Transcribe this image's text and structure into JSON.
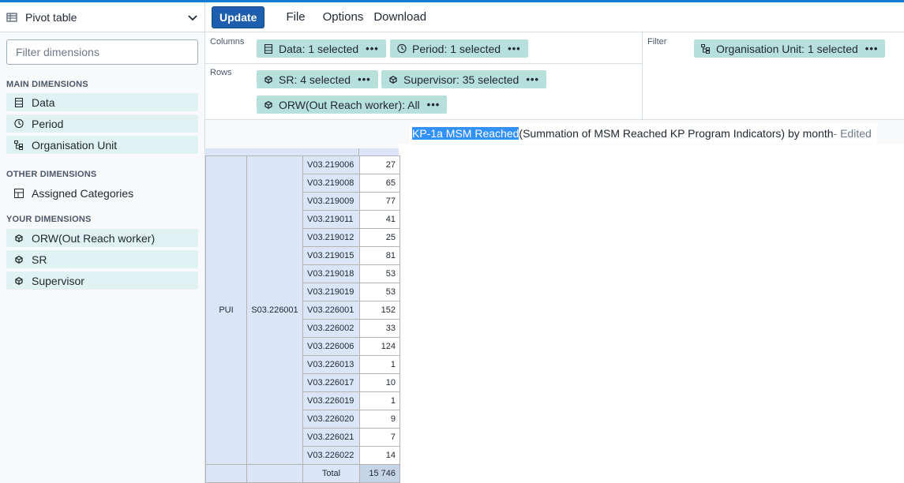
{
  "sidebar": {
    "vis_type": "Pivot table",
    "filter_placeholder": "Filter dimensions",
    "main_header": "MAIN DIMENSIONS",
    "main_items": [
      {
        "label": "Data",
        "icon": "data-icon"
      },
      {
        "label": "Period",
        "icon": "clock-icon"
      },
      {
        "label": "Organisation Unit",
        "icon": "org-tree-icon"
      }
    ],
    "other_header": "OTHER DIMENSIONS",
    "other_items": [
      {
        "label": "Assigned Categories",
        "icon": "grid-icon"
      }
    ],
    "your_header": "YOUR DIMENSIONS",
    "your_items": [
      {
        "label": "ORW(Out Reach worker)",
        "icon": "cube-icon"
      },
      {
        "label": "SR",
        "icon": "cube-icon"
      },
      {
        "label": "Supervisor",
        "icon": "cube-icon"
      }
    ]
  },
  "menubar": {
    "update": "Update",
    "file": "File",
    "options": "Options",
    "download": "Download"
  },
  "layout": {
    "columns_label": "Columns",
    "rows_label": "Rows",
    "filter_label": "Filter",
    "columns": [
      {
        "label": "Data: 1 selected",
        "icon": "data-icon"
      },
      {
        "label": "Period: 1 selected",
        "icon": "clock-icon"
      }
    ],
    "rows": [
      {
        "label": "SR: 4 selected",
        "icon": "cube-icon"
      },
      {
        "label": "Supervisor: 35 selected",
        "icon": "cube-icon"
      },
      {
        "label": "ORW(Out Reach worker): All",
        "icon": "cube-icon"
      }
    ],
    "filter": [
      {
        "label": "Organisation Unit: 1 selected",
        "icon": "org-tree-icon"
      }
    ],
    "dots": "•••"
  },
  "title": {
    "highlighted": "KP-1a MSM Reached",
    "rest": " (Summation of MSM Reached KP Program Indicators) by month",
    "edited": " - Edited"
  },
  "pivot": {
    "sr": "PUI",
    "supervisor": "S03.226001",
    "rows": [
      {
        "orw": "V03.219006",
        "value": "27"
      },
      {
        "orw": "V03.219008",
        "value": "65"
      },
      {
        "orw": "V03.219009",
        "value": "77"
      },
      {
        "orw": "V03.219011",
        "value": "41"
      },
      {
        "orw": "V03.219012",
        "value": "25"
      },
      {
        "orw": "V03.219015",
        "value": "81"
      },
      {
        "orw": "V03.219018",
        "value": "53"
      },
      {
        "orw": "V03.219019",
        "value": "53"
      },
      {
        "orw": "V03.226001",
        "value": "152"
      },
      {
        "orw": "V03.226002",
        "value": "33"
      },
      {
        "orw": "V03.226006",
        "value": "124"
      },
      {
        "orw": "V03.226013",
        "value": "1"
      },
      {
        "orw": "V03.226017",
        "value": "10"
      },
      {
        "orw": "V03.226019",
        "value": "1"
      },
      {
        "orw": "V03.226020",
        "value": "9"
      },
      {
        "orw": "V03.226021",
        "value": "7"
      },
      {
        "orw": "V03.226022",
        "value": "14"
      }
    ],
    "total_label": "Total",
    "total_value": "15 746"
  }
}
